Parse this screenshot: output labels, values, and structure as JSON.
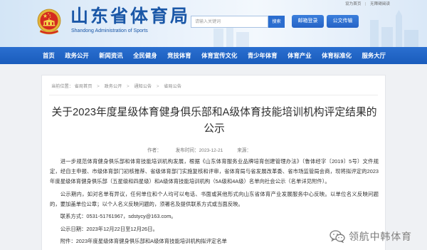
{
  "header": {
    "site_title": "山东省体育局",
    "site_subtitle": "Shandong Administration of Sports",
    "top_links": [
      "设为首页",
      "无障碍阅读"
    ],
    "top_links_separator": "|",
    "search": {
      "placeholder": "请输入关键词",
      "button_label": "搜索"
    },
    "actions": {
      "mail_login": "邮箱登录",
      "doc_transfer": "公文传输"
    },
    "emblem_icon": "national-emblem-icon"
  },
  "nav": {
    "items": [
      "首页",
      "政务公开",
      "新闻资讯",
      "全民健身",
      "竞技体育",
      "体育宣传文化",
      "青少年体育",
      "体育产业",
      "体育标准化",
      "服务大厅"
    ]
  },
  "breadcrumb": {
    "label": "当前位置：",
    "items": [
      "省局首页",
      "政务公开",
      "通知公告",
      "省局公告"
    ],
    "separator": ">"
  },
  "article": {
    "title": "关于2023年度星级体育健身俱乐部和A级体育技能培训机构评定结果的公示",
    "meta": {
      "author": "作者：",
      "publish_time": "发布时间：2023-12-21",
      "source": "来源："
    },
    "paragraphs": [
      "进一步规范体育健身俱乐部和体育技能培训机构发展，根据《山东体育服务业品牌培育创建管理办法》（鲁体经字〔2019〕5号）文件规定，经自主申报、市级体育部门初核推荐、省级体育部门实施复核和评审，省体育局与省发展改革委、省市场监管局会商，现将拟评定的2023年度星级体育健身俱乐部（五星级和四星级）和A级体育技能培训机构（5A级和4A级）名单向社会公示（名单详见附件）。",
      "公示期内，如对名单有异议，任何单位和个人均可以电话、书面或其他形式向山东省体育产业发展服务中心反映。以单位名义反映问题的，要加盖单位公章；以个人名义反映问题的，须署名及提供联系方式或当面反映。",
      "联系方式：0531-51761967，sdstycy@163.com。",
      "公示日期：2023年12月22日至12月26日。",
      "附件：2023年度星级体育健身俱乐部和A级体育技能培训机构拟评定名单"
    ]
  },
  "watermark": {
    "text": "领航中韩体育",
    "icon": "wechat-icon"
  },
  "colors": {
    "brand_blue": "#1a57a7",
    "nav_blue": "#1f63c4",
    "button_blue": "#2b6dcf",
    "page_background": "#eff1f4"
  }
}
